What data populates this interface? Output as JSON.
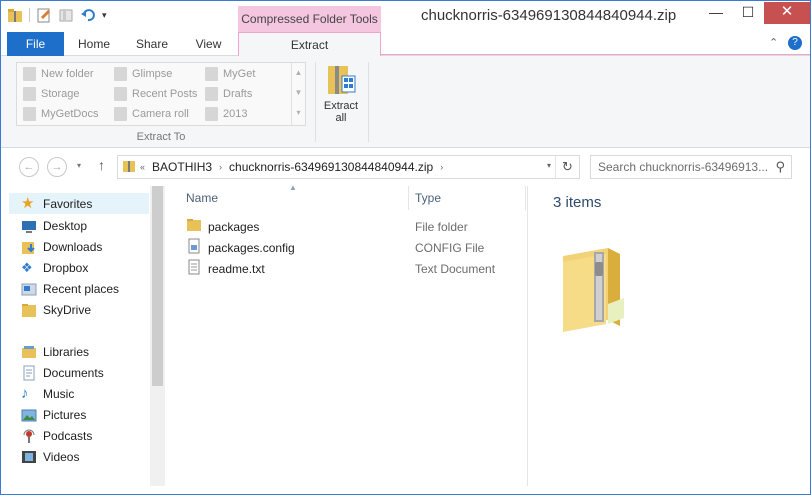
{
  "window": {
    "title": "chucknorris-634969130844840944.zip",
    "context_tab_header": "Compressed Folder Tools"
  },
  "ribbon": {
    "tabs": [
      "File",
      "Home",
      "Share",
      "View",
      "Extract"
    ],
    "gallery_items": [
      "New folder",
      "Glimpse",
      "MyGet",
      "Storage",
      "Recent Posts",
      "Drafts",
      "MyGetDocs",
      "Camera roll",
      "2013"
    ],
    "group_label": "Extract To",
    "extract_all_label_line1": "Extract",
    "extract_all_label_line2": "all"
  },
  "address": {
    "prefix": "«",
    "crumbs": [
      "BAOTHIH3",
      "chucknorris-634969130844840944.zip"
    ],
    "search_placeholder": "Search chucknorris-63496913..."
  },
  "nav_pane": {
    "favorites_label": "Favorites",
    "favorites": [
      "Desktop",
      "Downloads",
      "Dropbox",
      "Recent places",
      "SkyDrive"
    ],
    "libraries_label": "Libraries",
    "libraries": [
      "Documents",
      "Music",
      "Pictures",
      "Podcasts",
      "Videos"
    ]
  },
  "file_list": {
    "columns": [
      "Name",
      "Type"
    ],
    "rows": [
      {
        "name": "packages",
        "type": "File folder",
        "icon": "folder-icon"
      },
      {
        "name": "packages.config",
        "type": "CONFIG File",
        "icon": "config-file-icon"
      },
      {
        "name": "readme.txt",
        "type": "Text Document",
        "icon": "text-file-icon"
      }
    ]
  },
  "details": {
    "item_count": "3 items"
  },
  "colors": {
    "file_tab": "#1e6fc9",
    "context_tab": "#f4c6e0",
    "close_button": "#c75050",
    "selection": "#e5f3fb"
  }
}
